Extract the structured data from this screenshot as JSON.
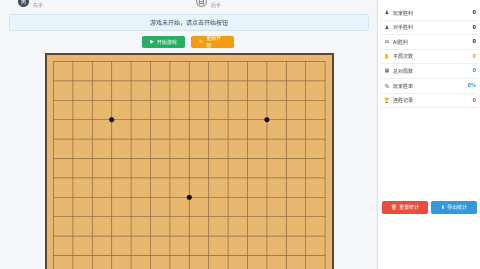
{
  "players": {
    "left": {
      "avatar": "黑",
      "role": "先手"
    },
    "right": {
      "avatar": "白",
      "role": "后手"
    }
  },
  "status": {
    "message": "游戏未开始，请点击开始按钮"
  },
  "buttons": {
    "start": {
      "icon": "▶",
      "label": "开始游戏"
    },
    "restart": {
      "icon": "↻",
      "label": "重新开始"
    }
  },
  "board": {
    "size": 15,
    "stones": [
      {
        "col": 3,
        "row": 3,
        "color": "black"
      },
      {
        "col": 11,
        "row": 3,
        "color": "black"
      },
      {
        "col": 7,
        "row": 7,
        "color": "black"
      }
    ]
  },
  "stats": [
    {
      "icon": "♟",
      "label": "玩家胜利",
      "value": "0",
      "color": "#333333"
    },
    {
      "icon": "♟",
      "label": "对手胜利",
      "value": "0",
      "color": "#333333"
    },
    {
      "icon": "⚖",
      "label": "AI胜利",
      "value": "0",
      "color": "#333333"
    },
    {
      "icon": "✋",
      "label": "平局次数",
      "value": "0",
      "color": "#f39c12"
    },
    {
      "icon": "▦",
      "label": "总对局数",
      "value": "0",
      "color": "#27ae60"
    },
    {
      "icon": "％",
      "label": "玩家胜率",
      "value": "0%",
      "color": "#3498db"
    },
    {
      "icon": "🏆",
      "label": "连胜记录",
      "value": "0",
      "color": "#e74c3c"
    }
  ],
  "sidebar_buttons": {
    "reset": {
      "icon": "🗑",
      "label": "重置统计"
    },
    "export": {
      "icon": "⬇",
      "label": "导出统计"
    }
  }
}
